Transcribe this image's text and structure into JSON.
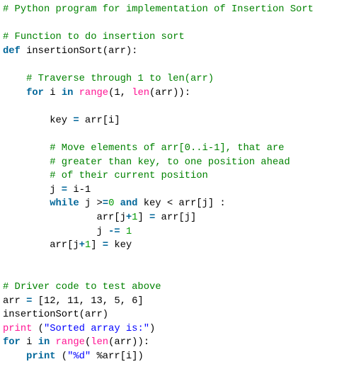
{
  "code": {
    "language": "python",
    "lines": [
      [
        {
          "t": "comment",
          "v": "# Python program for implementation of Insertion Sort"
        }
      ],
      [],
      [
        {
          "t": "comment",
          "v": "# Function to do insertion sort"
        }
      ],
      [
        {
          "t": "keyword",
          "v": "def"
        },
        {
          "t": "plain",
          "v": " insertionSort(arr):"
        }
      ],
      [],
      [
        {
          "t": "plain",
          "v": "    "
        },
        {
          "t": "comment",
          "v": "# Traverse through 1 to len(arr)"
        }
      ],
      [
        {
          "t": "plain",
          "v": "    "
        },
        {
          "t": "keyword",
          "v": "for"
        },
        {
          "t": "plain",
          "v": " i "
        },
        {
          "t": "keyword",
          "v": "in"
        },
        {
          "t": "plain",
          "v": " "
        },
        {
          "t": "builtin",
          "v": "range"
        },
        {
          "t": "plain",
          "v": "(1, "
        },
        {
          "t": "builtin",
          "v": "len"
        },
        {
          "t": "plain",
          "v": "(arr)):"
        }
      ],
      [],
      [
        {
          "t": "plain",
          "v": "        key "
        },
        {
          "t": "op",
          "v": "="
        },
        {
          "t": "plain",
          "v": " arr[i]"
        }
      ],
      [],
      [
        {
          "t": "plain",
          "v": "        "
        },
        {
          "t": "comment",
          "v": "# Move elements of arr[0..i-1], that are"
        }
      ],
      [
        {
          "t": "plain",
          "v": "        "
        },
        {
          "t": "comment",
          "v": "# greater than key, to one position ahead"
        }
      ],
      [
        {
          "t": "plain",
          "v": "        "
        },
        {
          "t": "comment",
          "v": "# of their current position"
        }
      ],
      [
        {
          "t": "plain",
          "v": "        j "
        },
        {
          "t": "op",
          "v": "="
        },
        {
          "t": "plain",
          "v": " i-1"
        }
      ],
      [
        {
          "t": "plain",
          "v": "        "
        },
        {
          "t": "keyword",
          "v": "while"
        },
        {
          "t": "plain",
          "v": " j >"
        },
        {
          "t": "op",
          "v": "="
        },
        {
          "t": "number",
          "v": "0"
        },
        {
          "t": "plain",
          "v": " "
        },
        {
          "t": "keyword",
          "v": "and"
        },
        {
          "t": "plain",
          "v": " key < arr[j] :"
        }
      ],
      [
        {
          "t": "plain",
          "v": "                arr[j"
        },
        {
          "t": "op",
          "v": "+"
        },
        {
          "t": "number",
          "v": "1"
        },
        {
          "t": "plain",
          "v": "] "
        },
        {
          "t": "op",
          "v": "="
        },
        {
          "t": "plain",
          "v": " arr[j]"
        }
      ],
      [
        {
          "t": "plain",
          "v": "                j "
        },
        {
          "t": "op",
          "v": "-="
        },
        {
          "t": "plain",
          "v": " "
        },
        {
          "t": "number",
          "v": "1"
        }
      ],
      [
        {
          "t": "plain",
          "v": "        arr[j"
        },
        {
          "t": "op",
          "v": "+"
        },
        {
          "t": "number",
          "v": "1"
        },
        {
          "t": "plain",
          "v": "] "
        },
        {
          "t": "op",
          "v": "="
        },
        {
          "t": "plain",
          "v": " key"
        }
      ],
      [],
      [],
      [
        {
          "t": "comment",
          "v": "# Driver code to test above"
        }
      ],
      [
        {
          "t": "plain",
          "v": "arr "
        },
        {
          "t": "op",
          "v": "="
        },
        {
          "t": "plain",
          "v": " [12, 11, 13, 5, 6]"
        }
      ],
      [
        {
          "t": "plain",
          "v": "insertionSort(arr)"
        }
      ],
      [
        {
          "t": "builtin",
          "v": "print"
        },
        {
          "t": "plain",
          "v": " ("
        },
        {
          "t": "string",
          "v": "\"Sorted array is:\""
        },
        {
          "t": "plain",
          "v": ")"
        }
      ],
      [
        {
          "t": "keyword",
          "v": "for"
        },
        {
          "t": "plain",
          "v": " i "
        },
        {
          "t": "keyword",
          "v": "in"
        },
        {
          "t": "plain",
          "v": " "
        },
        {
          "t": "builtin",
          "v": "range"
        },
        {
          "t": "plain",
          "v": "("
        },
        {
          "t": "builtin",
          "v": "len"
        },
        {
          "t": "plain",
          "v": "(arr)):"
        }
      ],
      [
        {
          "t": "plain",
          "v": "    "
        },
        {
          "t": "keyword",
          "v": "print"
        },
        {
          "t": "plain",
          "v": " ("
        },
        {
          "t": "string",
          "v": "\"%d\""
        },
        {
          "t": "plain",
          "v": " %arr[i])"
        }
      ]
    ]
  },
  "colors": {
    "comment": "#008200",
    "keyword": "#006699",
    "builtin": "#ff1493",
    "string": "#0000ff",
    "number": "#009900",
    "plain": "#000000",
    "background": "#ffffff"
  }
}
